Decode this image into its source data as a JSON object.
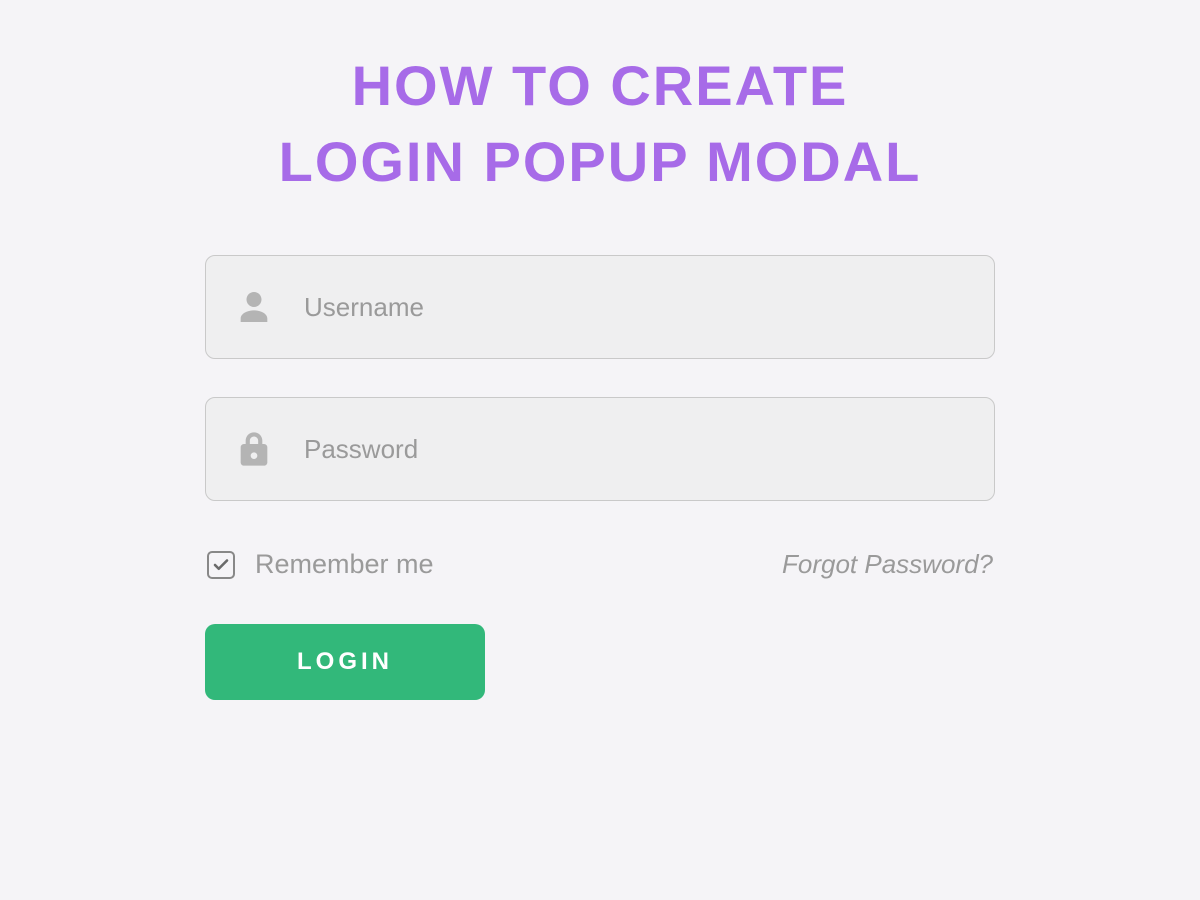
{
  "heading": {
    "line1": "HOW TO CREATE",
    "line2": "LOGIN POPUP MODAL"
  },
  "form": {
    "username": {
      "placeholder": "Username",
      "value": ""
    },
    "password": {
      "placeholder": "Password",
      "value": ""
    },
    "remember": {
      "label": "Remember me",
      "checked": true
    },
    "forgot_label": "Forgot Password?",
    "login_label": "LOGIN"
  }
}
